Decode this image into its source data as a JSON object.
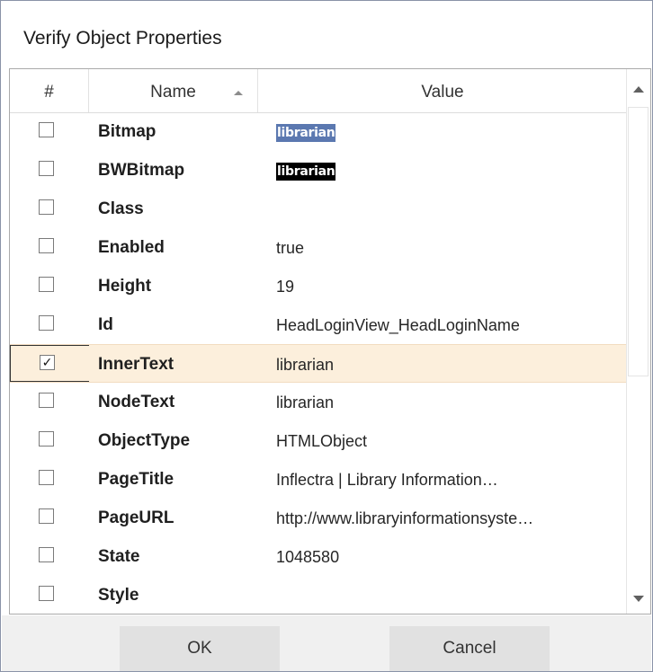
{
  "dialog": {
    "title": "Verify Object Properties"
  },
  "grid": {
    "columns": {
      "number": "#",
      "name": "Name",
      "value": "Value"
    },
    "sort_column": "name",
    "sort_direction": "ascending",
    "rows": [
      {
        "checked": false,
        "name": "Bitmap",
        "value": "librarian",
        "value_kind": "bitmap-color"
      },
      {
        "checked": false,
        "name": "BWBitmap",
        "value": "librarian",
        "value_kind": "bitmap-bw"
      },
      {
        "checked": false,
        "name": "Class",
        "value": "",
        "value_kind": "text"
      },
      {
        "checked": false,
        "name": "Enabled",
        "value": "true",
        "value_kind": "text"
      },
      {
        "checked": false,
        "name": "Height",
        "value": "19",
        "value_kind": "text"
      },
      {
        "checked": false,
        "name": "Id",
        "value": "HeadLoginView_HeadLoginName",
        "value_kind": "text"
      },
      {
        "checked": true,
        "name": "InnerText",
        "value": "librarian",
        "value_kind": "text",
        "selected": true
      },
      {
        "checked": false,
        "name": "NodeText",
        "value": "librarian",
        "value_kind": "text"
      },
      {
        "checked": false,
        "name": "ObjectType",
        "value": "HTMLObject",
        "value_kind": "text"
      },
      {
        "checked": false,
        "name": "PageTitle",
        "value": "Inflectra | Library Information…",
        "value_kind": "text"
      },
      {
        "checked": false,
        "name": "PageURL",
        "value": "http://www.libraryinformationsyste…",
        "value_kind": "text"
      },
      {
        "checked": false,
        "name": "State",
        "value": "1048580",
        "value_kind": "text"
      },
      {
        "checked": false,
        "name": "Style",
        "value": "",
        "value_kind": "text"
      }
    ],
    "check_glyph": "✓"
  },
  "buttons": {
    "ok": "OK",
    "cancel": "Cancel"
  },
  "colors": {
    "selected_row": "#fcefdc",
    "bitmap_bg": "#5b78b0",
    "footer_bg": "#f0f0f0",
    "button_bg": "#e1e1e1"
  }
}
